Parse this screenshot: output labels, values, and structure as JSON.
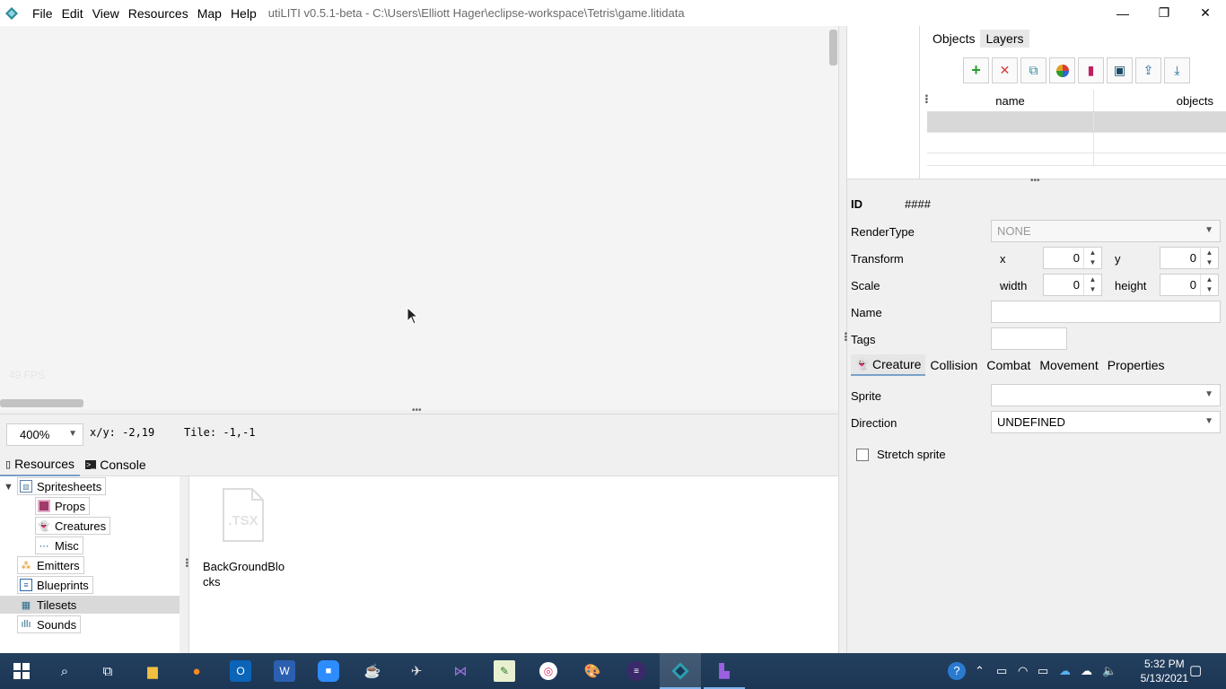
{
  "window": {
    "title": "utiLITI v0.5.1-beta - C:\\Users\\Elliott Hager\\eclipse-workspace\\Tetris\\game.litidata",
    "minimize": "—",
    "maximize": "❐",
    "close": "✕"
  },
  "menu": [
    "File",
    "Edit",
    "View",
    "Resources",
    "Map",
    "Help"
  ],
  "map": {
    "fps": "49 FPS"
  },
  "status": {
    "zoom": "400%",
    "xy": "x/y: -2,19",
    "tile": "Tile: -1,-1"
  },
  "bottom_tabs": [
    {
      "label": "Resources",
      "icon": "resources-icon"
    },
    {
      "label": "Console",
      "icon": "console-icon"
    }
  ],
  "tree": {
    "items": [
      {
        "label": "Spritesheets",
        "icon": "spritesheet-icon"
      },
      {
        "label": "Props",
        "icon": "prop-icon"
      },
      {
        "label": "Creatures",
        "icon": "creature-icon"
      },
      {
        "label": "Misc",
        "icon": "misc-icon"
      },
      {
        "label": "Emitters",
        "icon": "emitter-icon"
      },
      {
        "label": "Blueprints",
        "icon": "blueprint-icon"
      },
      {
        "label": "Tilesets",
        "icon": "tileset-icon"
      },
      {
        "label": "Sounds",
        "icon": "sound-icon"
      }
    ]
  },
  "resource_pane": {
    "file_ext": ".TSX",
    "file_label": "BackGroundBlocks"
  },
  "objects_panel": {
    "tabs": [
      "Objects",
      "Layers"
    ],
    "table_headers": [
      "name",
      "objects"
    ]
  },
  "props": {
    "id_label": "ID",
    "id_value": "####",
    "rendertype_label": "RenderType",
    "rendertype_value": "NONE",
    "transform_label": "Transform",
    "x_label": "x",
    "x_value": "0",
    "y_label": "y",
    "y_value": "0",
    "scale_label": "Scale",
    "width_label": "width",
    "width_value": "0",
    "height_label": "height",
    "height_value": "0",
    "name_label": "Name",
    "name_value": "",
    "tags_label": "Tags",
    "tags_value": "",
    "sub_tabs": [
      "Creature",
      "Collision",
      "Combat",
      "Movement",
      "Properties"
    ],
    "sprite_label": "Sprite",
    "sprite_value": "",
    "direction_label": "Direction",
    "direction_value": "UNDEFINED",
    "stretch_label": "Stretch sprite"
  },
  "taskbar": {
    "time": "5:32 PM",
    "date": "5/13/2021"
  },
  "colors": {
    "accent": "#7aa0c8",
    "taskbar": "#1f3a5a",
    "add_green": "#2a9d2a",
    "delete_red": "#d93a3a"
  }
}
